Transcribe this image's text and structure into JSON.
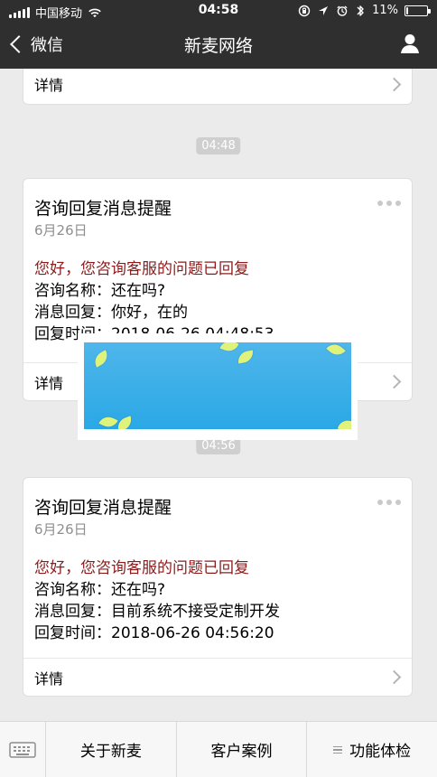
{
  "status_bar": {
    "carrier": "中国移动",
    "time": "04:58",
    "battery_percent": "11%",
    "battery_level": 0.11
  },
  "nav": {
    "back_label": "微信",
    "title": "新麦网络"
  },
  "messages": {
    "top_partial": {
      "details_label": "详情"
    },
    "time1": "04:48",
    "card1": {
      "title": "咨询回复消息提醒",
      "date": "6月26日",
      "greeting": "您好，您咨询客服的问题已回复",
      "name_line": "咨询名称：还在吗?",
      "reply_line": "消息回复：你好，在的",
      "time_line": "回复时间：2018-06-26 04:48:53",
      "details_label": "详情"
    },
    "time2": "04:56",
    "card2": {
      "title": "咨询回复消息提醒",
      "date": "6月26日",
      "greeting": "您好，您咨询客服的问题已回复",
      "name_line": "咨询名称：还在吗?",
      "reply_line": "消息回复：目前系统不接受定制开发",
      "time_line": "回复时间：2018-06-26 04:56:20",
      "details_label": "详情"
    }
  },
  "bottom_menu": {
    "item1": "关于新麦",
    "item2": "客户案例",
    "item3": "功能体检"
  },
  "colors": {
    "nav_bg": "#2f2f2f",
    "chat_bg": "#ebebeb",
    "greeting_red": "#8b1b1b",
    "time_pill": "#cfcfcf"
  },
  "icons": {
    "signal": "signal-icon",
    "wifi": "wifi-icon",
    "back": "chevron-left-icon",
    "profile": "user-icon",
    "more": "more-icon",
    "details": "chevron-right-icon",
    "keyboard": "keyboard-icon",
    "menu": "menu-icon"
  }
}
